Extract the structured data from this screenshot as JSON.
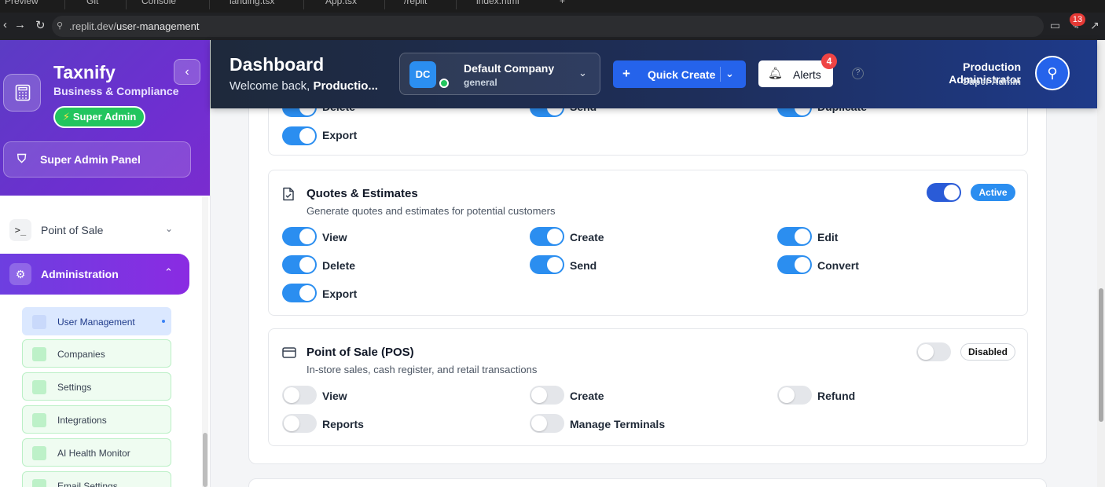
{
  "browser": {
    "tabs": [
      "Preview",
      "Git",
      "Console",
      "landing.tsx",
      "App.tsx",
      "/replit",
      "index.html"
    ],
    "url_host": ".replit.dev/",
    "url_path": "user-management",
    "extension_badge": "13"
  },
  "sidebar": {
    "brand": "Taxnify",
    "brand_sub": "Business & Compliance",
    "role_pill": "Super Admin",
    "panel_button": "Super Admin Panel",
    "nav_pos": "Point of Sale",
    "nav_admin": "Administration",
    "sub_items": [
      "User Management",
      "Companies",
      "Settings",
      "Integrations",
      "AI Health Monitor",
      "Email Settings"
    ]
  },
  "header": {
    "title": "Dashboard",
    "welcome_prefix": "Welcome back, ",
    "welcome_name": "Productio...",
    "company_initials": "DC",
    "company_name": "Default Company",
    "company_sub": "general",
    "quick_create": "Quick Create",
    "alerts_label": "Alerts",
    "alerts_count": "4",
    "help": "?",
    "user_name": "Production Administrator",
    "user_role": "Super Admin"
  },
  "content": {
    "prev_module": {
      "perms_partial": [
        "Delete",
        "Send",
        "Duplicate"
      ],
      "perm_export": "Export"
    },
    "quotes": {
      "title": "Quotes & Estimates",
      "description": "Generate quotes and estimates for potential customers",
      "status": "Active",
      "enabled": true,
      "perms": [
        "View",
        "Create",
        "Edit",
        "Delete",
        "Send",
        "Convert",
        "Export"
      ]
    },
    "pos": {
      "title": "Point of Sale (POS)",
      "description": "In-store sales, cash register, and retail transactions",
      "status": "Disabled",
      "enabled": false,
      "perms": [
        "View",
        "Create",
        "Refund",
        "Reports",
        "Manage Terminals"
      ]
    }
  },
  "colors": {
    "accent": "#2b8ef0",
    "sidebar_gradient_start": "#5b3cc4",
    "sidebar_gradient_end": "#7a2ccf",
    "header_start": "#1e293b",
    "header_end": "#1e3a8a"
  }
}
